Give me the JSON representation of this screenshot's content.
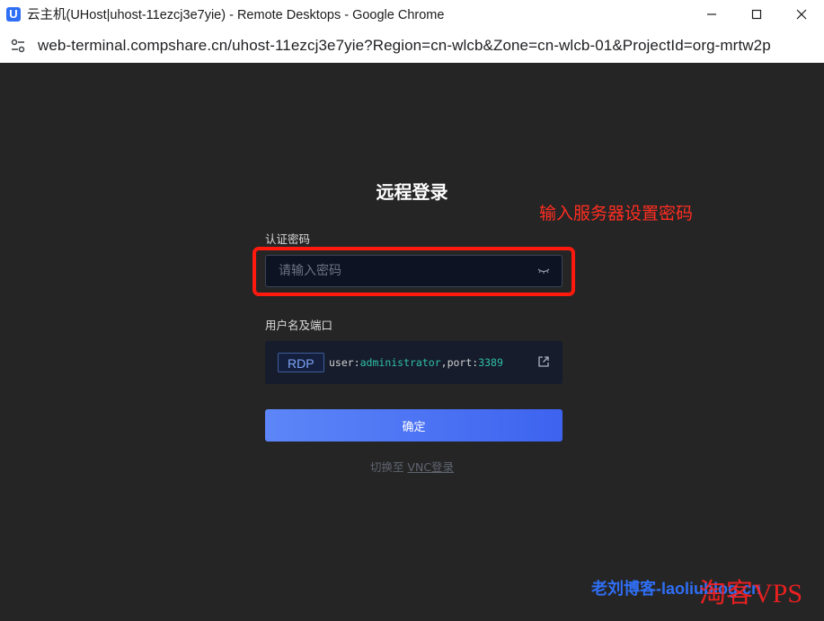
{
  "window": {
    "logo_letter": "U",
    "title": "云主机(UHost|uhost-11ezcj3e7yie) - Remote Desktops - Google Chrome"
  },
  "address_bar": {
    "url": "web-terminal.compshare.cn/uhost-11ezcj3e7yie?Region=cn-wlcb&Zone=cn-wlcb-01&ProjectId=org-mrtw2p"
  },
  "login": {
    "title": "远程登录",
    "password_label": "认证密码",
    "password_placeholder": "请输入密码",
    "user_port_label": "用户名及端口",
    "protocol_tag": "RDP",
    "user_key": "user:",
    "user_value": "administrator",
    "port_key": ",port:",
    "port_value": "3389",
    "confirm_label": "确定",
    "switch_prefix": "切换至 ",
    "switch_link": "VNC登录"
  },
  "annotation": {
    "text": "输入服务器设置密码",
    "color": "#ff2d20"
  },
  "watermark": {
    "left_text": "老刘博客-laoliublog.cn",
    "right_text": "淘客VPS"
  },
  "colors": {
    "background": "#252526",
    "accent": "#4a72f5",
    "highlight_box": "#ff1a0d",
    "value_teal": "#2fbfa8"
  },
  "icons": [
    "app-logo",
    "minimize-icon",
    "maximize-icon",
    "close-icon",
    "site-info-icon",
    "eye-closed-icon",
    "copy-icon"
  ]
}
